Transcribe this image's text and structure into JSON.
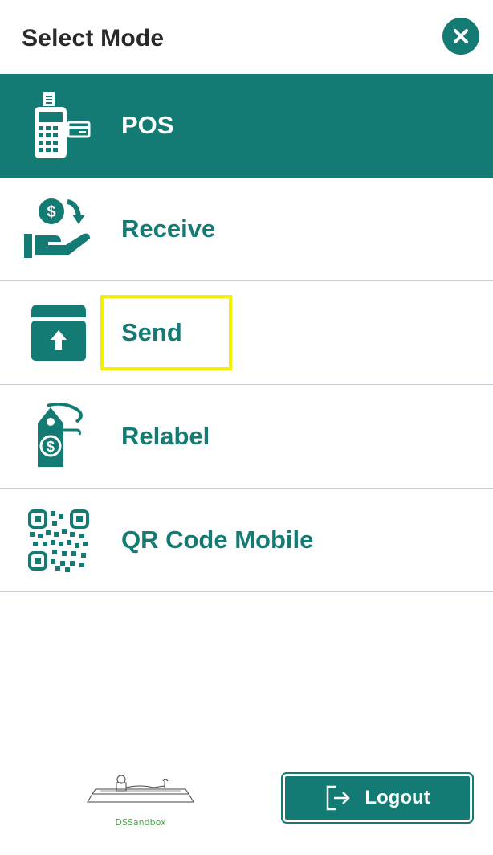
{
  "header": {
    "title": "Select Mode",
    "close_icon": "close-icon"
  },
  "menu": {
    "items": [
      {
        "label": "POS",
        "icon": "pos-terminal-icon",
        "active": true
      },
      {
        "label": "Receive",
        "icon": "receive-money-icon",
        "active": false
      },
      {
        "label": "Send",
        "icon": "send-box-icon",
        "active": false
      },
      {
        "label": "Relabel",
        "icon": "price-tag-icon",
        "active": false
      },
      {
        "label": "QR Code Mobile",
        "icon": "qr-code-icon",
        "active": false
      }
    ]
  },
  "footer": {
    "logo_text": "DSSandbox",
    "logout_label": "Logout"
  },
  "colors": {
    "accent": "#147a74",
    "highlight": "#f2f200",
    "divider": "#c9cdd3",
    "logo_text": "#4aa84a"
  }
}
